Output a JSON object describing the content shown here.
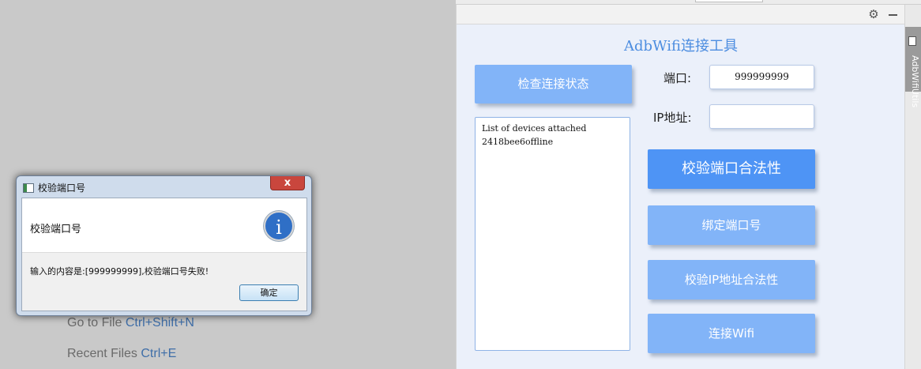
{
  "ide": {
    "go_to_file_text": "Go to File",
    "go_to_file_shortcut": "Ctrl+Shift+N",
    "recent_files_text": "Recent Files",
    "recent_files_shortcut": "Ctrl+E"
  },
  "tool_window": {
    "side_tab_label": "AdbWifiUtils",
    "icons": [
      "gear-icon",
      "hide-icon"
    ]
  },
  "plugin": {
    "title": "AdbWifi连接工具",
    "check_status_button": "检查连接状态",
    "port_label": "端口:",
    "port_value": "999999999",
    "ip_label": "IP地址:",
    "ip_value": "",
    "device_list": [
      "List of devices attached",
      "2418bee6offline"
    ],
    "validate_port_button": "校验端口合法性",
    "bind_port_button": "绑定端口号",
    "validate_ip_button": "校验IP地址合法性",
    "connect_wifi_button": "连接Wifi"
  },
  "dialog": {
    "window_title": "校验端口号",
    "header": "校验端口号",
    "message": "输入的内容是:[999999999],校验端口号失败!",
    "ok_button": "确定",
    "close_glyph": "x",
    "info_glyph": "i"
  },
  "colors": {
    "accent": "#4e94f5",
    "button": "#82b4f8",
    "plugin_bg": "#ebf0fa",
    "title": "#4c8de0"
  }
}
